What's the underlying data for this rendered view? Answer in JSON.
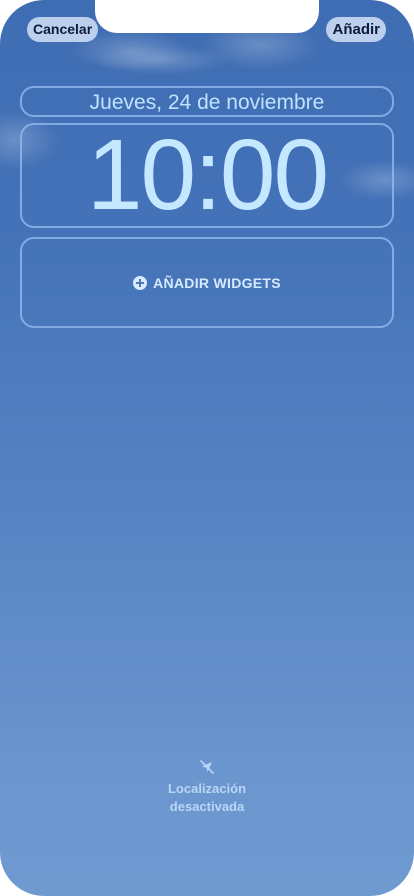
{
  "toolbar": {
    "cancel_label": "Cancelar",
    "add_label": "Añadir"
  },
  "lock_screen": {
    "date": "Jueves, 24 de noviembre",
    "time": "10:00",
    "add_widgets_label": "AÑADIR WIDGETS"
  },
  "location_status": {
    "line1": "Localización",
    "line2": "desactivada",
    "icon": "location-disabled-icon"
  },
  "colors": {
    "sky_top": "#3f6db3",
    "sky_bottom": "#6f9ad0",
    "clock_text": "#c4e8ff",
    "button_bg": "#cddef5"
  }
}
